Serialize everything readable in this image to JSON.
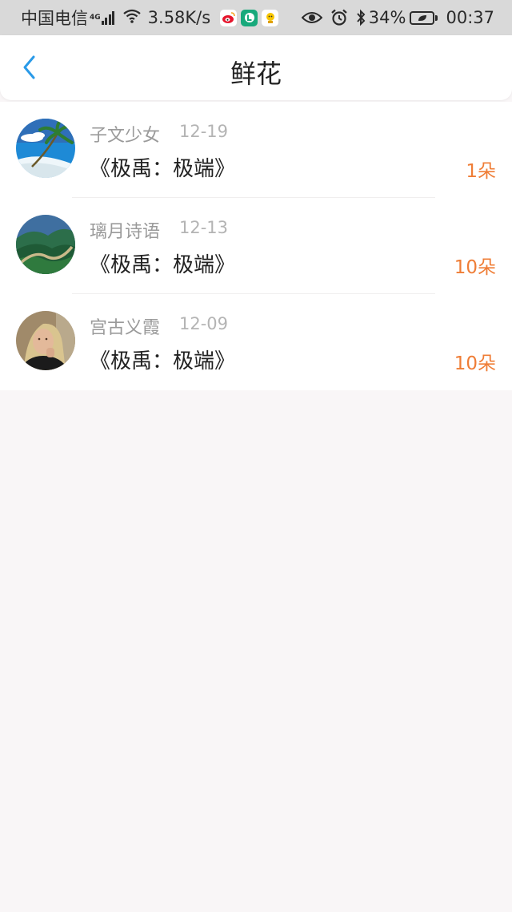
{
  "status_bar": {
    "carrier": "中国电信",
    "network_type": "4G",
    "speed": "3.58K/s",
    "battery": "34%",
    "time": "00:37",
    "icons": [
      "signal-icon",
      "wifi-icon",
      "weibo-app-icon",
      "green-app-icon",
      "yellow-app-icon",
      "eye-icon",
      "alarm-icon",
      "bluetooth-icon",
      "battery-icon"
    ]
  },
  "header": {
    "title": "鲜花",
    "back_icon": "chevron-left-icon",
    "accent_color": "#2a9ae8"
  },
  "records": [
    {
      "user": "子文少女",
      "date": "12-19",
      "book": "《极禹：极端》",
      "count": "1朵",
      "avatar": "palm-beach-avatar"
    },
    {
      "user": "璃月诗语",
      "date": "12-13",
      "book": "《极禹：极端》",
      "count": "10朵",
      "avatar": "great-wall-avatar"
    },
    {
      "user": "宫古义霞",
      "date": "12-09",
      "book": "《极禹：极端》",
      "count": "10朵",
      "avatar": "woman-portrait-avatar"
    }
  ],
  "colors": {
    "count": "#ef7d36",
    "background": "#f9f6f7"
  }
}
